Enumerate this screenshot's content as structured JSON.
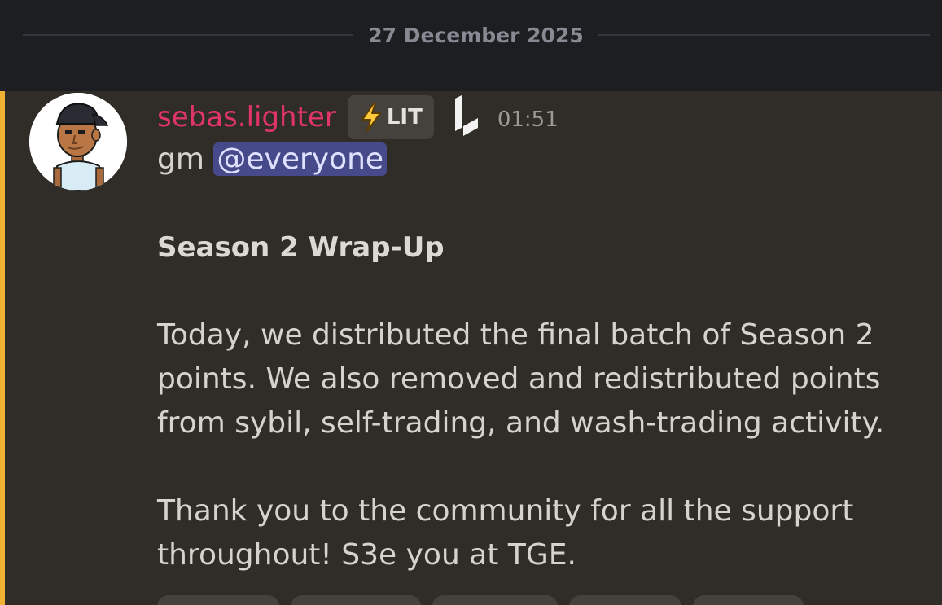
{
  "divider": {
    "date": "27 December 2025"
  },
  "message": {
    "author": "sebas.lighter",
    "author_color": "#e1346b",
    "role_tag": {
      "icon": "lightning-bolt-icon",
      "label": "LIT"
    },
    "server_icon": "lighter-logo-icon",
    "timestamp": "01:51",
    "greeting": "gm",
    "mention": "@everyone",
    "heading": "Season 2 Wrap-Up",
    "paragraph1": [
      "Today, we distributed the final batch of Season 2",
      "points. We also removed and redistributed points",
      "from sybil, self-trading, and wash-trading activity."
    ],
    "paragraph2": [
      "Thank you to the community for all the support",
      "throughout! S3e you at TGE."
    ]
  },
  "colors": {
    "accent_bar": "#f0b232",
    "mention_bg": "#474a8a",
    "message_bg": "#302c27"
  }
}
